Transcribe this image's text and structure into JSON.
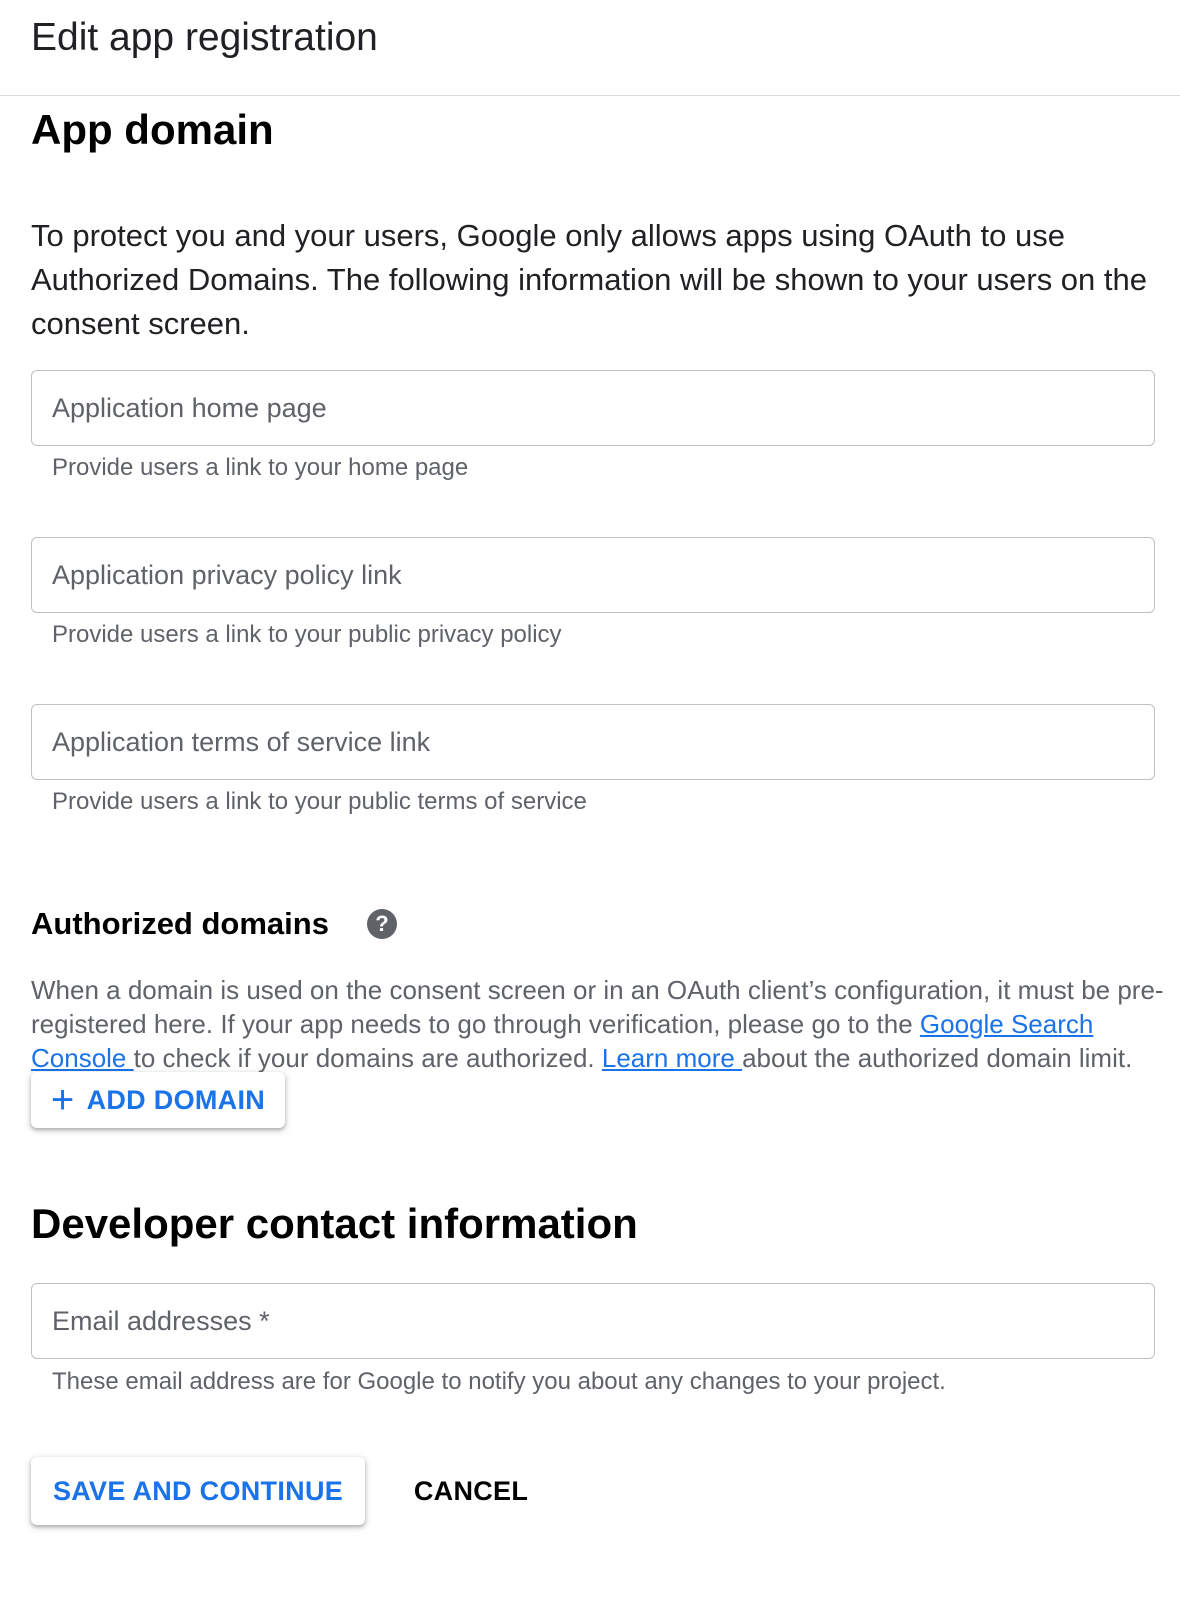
{
  "header": {
    "title": "Edit app registration"
  },
  "app_domain": {
    "heading": "App domain",
    "intro": "To protect you and your users, Google only allows apps using OAuth to use Authorized Domains. The following information will be shown to your users on the consent screen.",
    "home_page": {
      "placeholder": "Application home page",
      "hint": "Provide users a link to your home page"
    },
    "privacy_policy": {
      "placeholder": "Application privacy policy link",
      "hint": "Provide users a link to your public privacy policy"
    },
    "terms_of_service": {
      "placeholder": "Application terms of service link",
      "hint": "Provide users a link to your public terms of service"
    }
  },
  "authorized_domains": {
    "heading": "Authorized domains",
    "help_icon": "question-circle-icon",
    "desc_part1": "When a domain is used on the consent screen or in an OAuth client’s configuration, it must be pre-registered here. If your app needs to go through verification, please go to the ",
    "link_search_console": "Google Search Console ",
    "desc_part2": "to check if your domains are authorized. ",
    "link_learn_more": "Learn more ",
    "desc_part3": "about the authorized domain limit.",
    "add_button_icon": "+",
    "add_button_label": "ADD DOMAIN"
  },
  "developer_contact": {
    "heading": "Developer contact information",
    "email": {
      "placeholder": "Email addresses *",
      "hint": "These email address are for Google to notify you about any changes to your project."
    }
  },
  "actions": {
    "save_label": "SAVE AND CONTINUE",
    "cancel_label": "CANCEL"
  },
  "colors": {
    "accent": "#1a73e8",
    "border": "#bdc1c6",
    "secondary_text": "#5f6368"
  }
}
